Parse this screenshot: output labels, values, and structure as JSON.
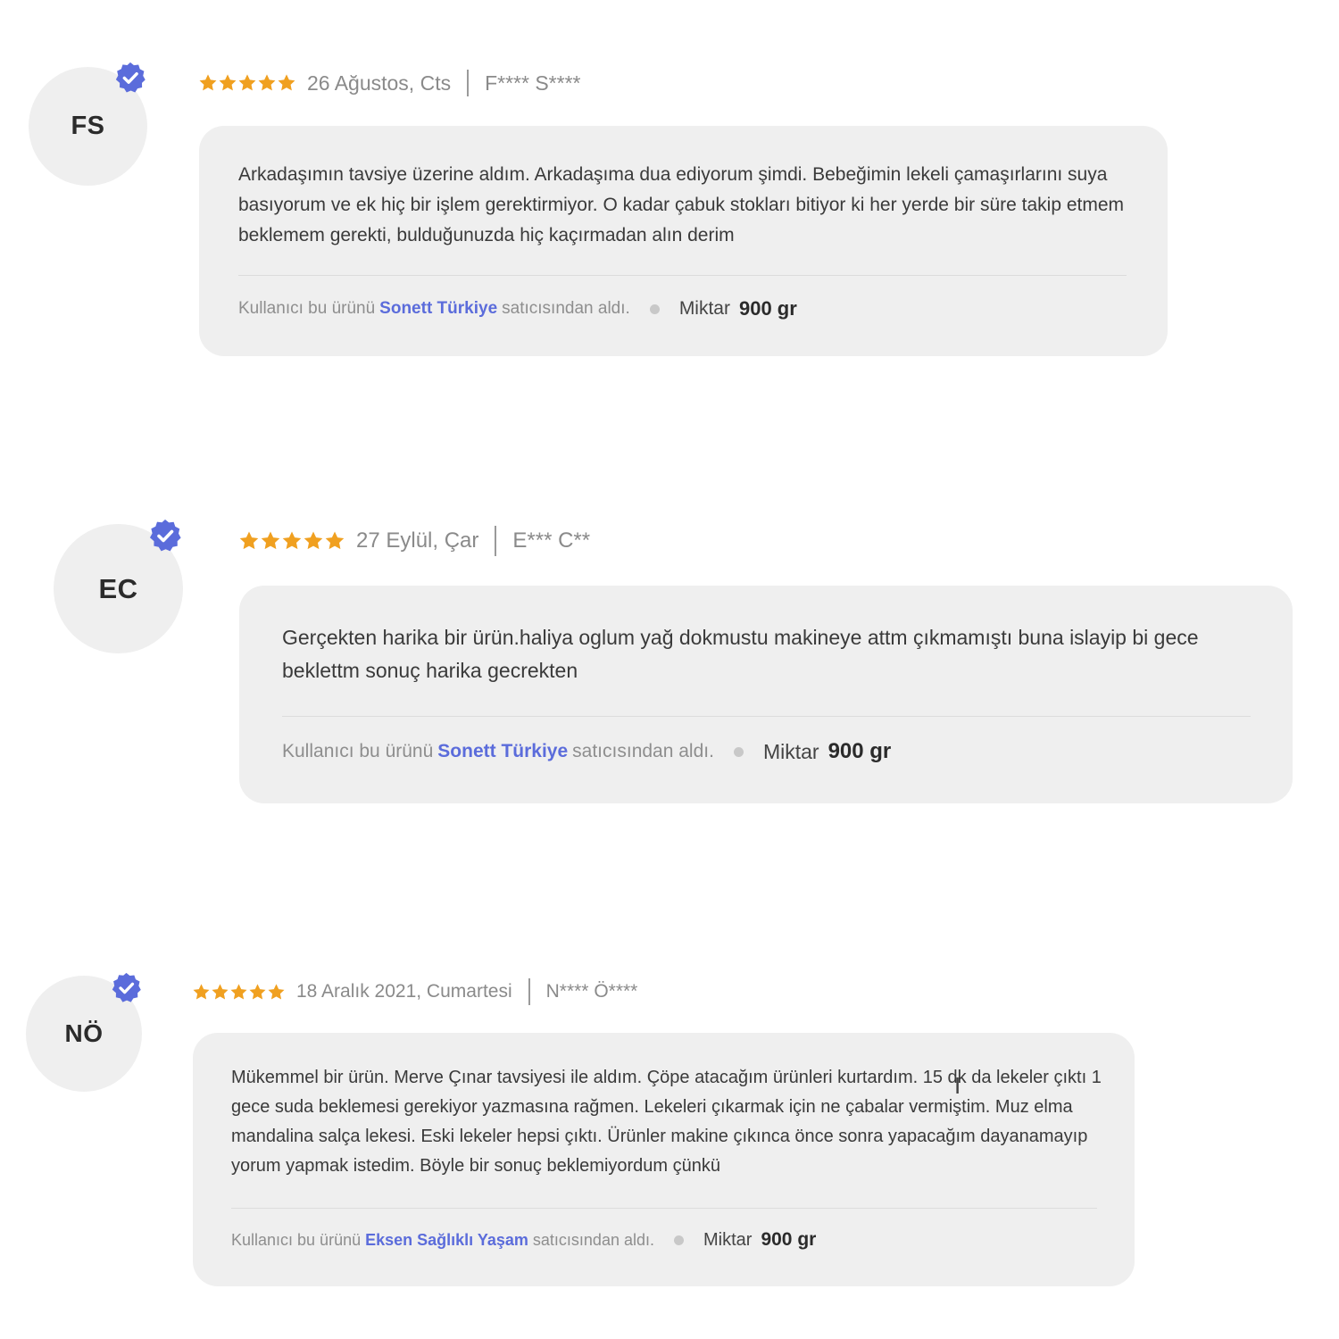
{
  "colors": {
    "star": "#f0a020",
    "verified": "#5b6cdb",
    "seller_link": "#5b6cdb",
    "card_bg": "#efefef"
  },
  "reviews": [
    {
      "initials": "FS",
      "rating": 5,
      "date": "26 Ağustos, Cts",
      "author": "F**** S****",
      "text": "Arkadaşımın tavsiye üzerine aldım. Arkadaşıma dua ediyorum şimdi. Bebeğimin lekeli çamaşırlarını suya basıyorum ve ek hiç bir işlem gerektirmiyor. O kadar çabuk stokları bitiyor ki her yerde bir süre takip etmem beklemem gerekti, bulduğunuzda hiç kaçırmadan alın derim",
      "footer_prefix": "Kullanıcı bu ürünü",
      "seller": "Sonett Türkiye",
      "footer_suffix": "satıcısından aldı.",
      "qty_label": "Miktar",
      "qty_value": "900 gr",
      "verified_icon": "verified-check-icon"
    },
    {
      "initials": "EC",
      "rating": 5,
      "date": "27 Eylül, Çar",
      "author": "E*** C**",
      "text": "Gerçekten harika bir ürün.haliya oglum yağ dokmustu makineye attm çıkmamıştı buna islayip bi gece beklettm sonuç harika gecrekten",
      "footer_prefix": "Kullanıcı bu ürünü",
      "seller": "Sonett Türkiye",
      "footer_suffix": "satıcısından aldı.",
      "qty_label": "Miktar",
      "qty_value": "900 gr",
      "verified_icon": "verified-check-icon"
    },
    {
      "initials": "NÖ",
      "rating": 5,
      "date": "18 Aralık 2021, Cumartesi",
      "author": "N**** Ö****",
      "text": "Mükemmel bir ürün. Merve Çınar tavsiyesi ile aldım. Çöpe atacağım ürünleri kurtardım. 15 dk da lekeler çıktı 1 gece suda beklemesi gerekiyor yazmasına rağmen. Lekeleri çıkarmak için ne çabalar vermiştim. Muz elma mandalina salça lekesi. Eski lekeler hepsi çıktı. Ürünler makine çıkınca önce sonra yapacağım dayanamayıp yorum yapmak istedim. Böyle bir sonuç beklemiyordum çünkü",
      "footer_prefix": "Kullanıcı bu ürünü",
      "seller": "Eksen Sağlıklı Yaşam",
      "footer_suffix": "satıcısından aldı.",
      "qty_label": "Miktar",
      "qty_value": "900 gr",
      "verified_icon": "verified-check-icon"
    }
  ]
}
